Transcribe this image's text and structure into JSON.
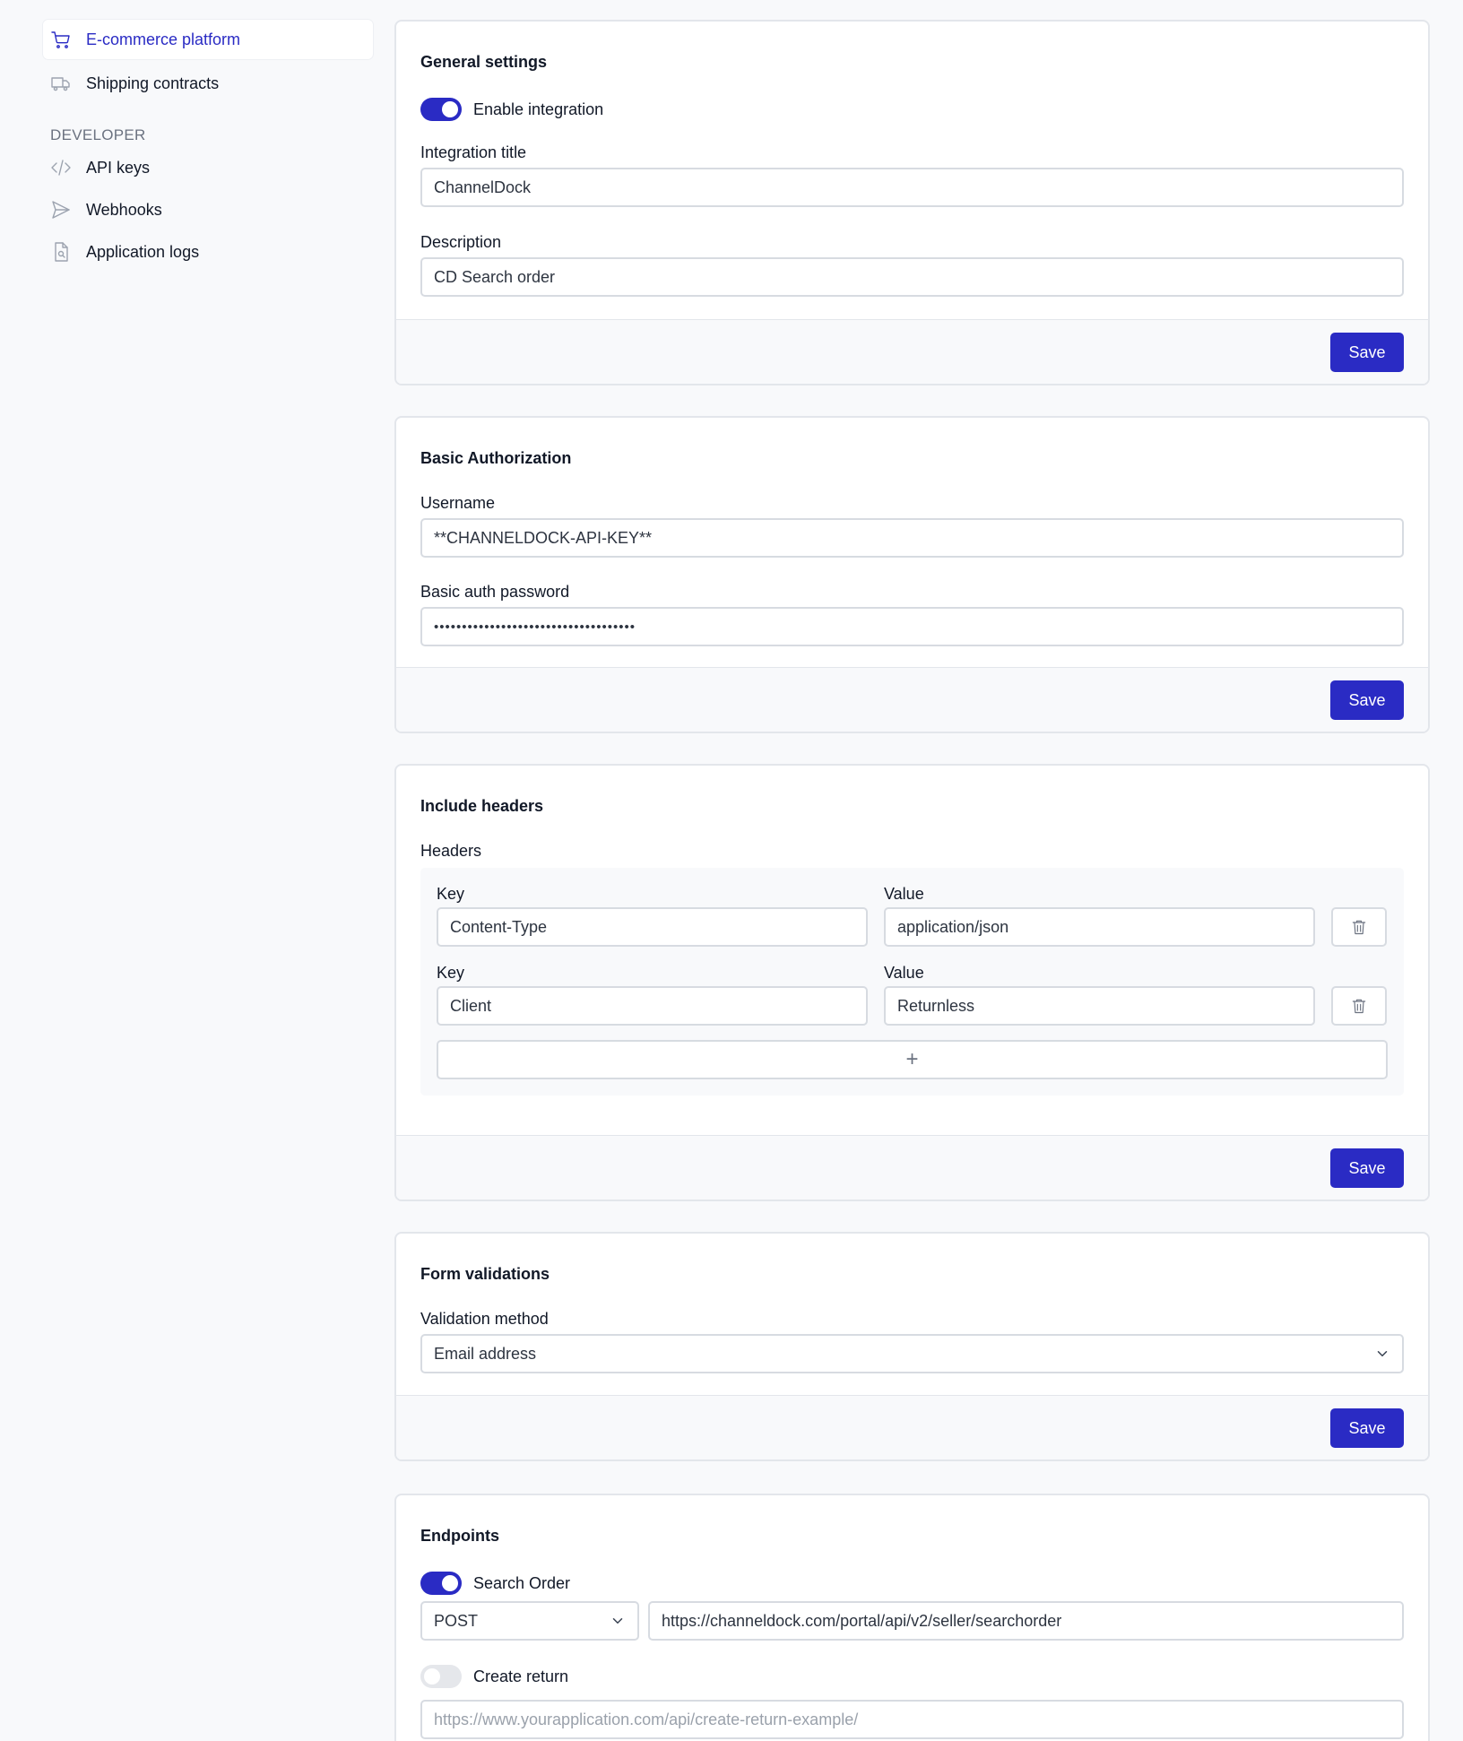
{
  "sidebar": {
    "items": [
      {
        "label": "E-commerce platform",
        "icon": "cart-icon",
        "active": true
      },
      {
        "label": "Shipping contracts",
        "icon": "truck-icon",
        "active": false
      }
    ],
    "developer_heading": "DEVELOPER",
    "developer_items": [
      {
        "label": "API keys",
        "icon": "code-icon"
      },
      {
        "label": "Webhooks",
        "icon": "send-icon"
      },
      {
        "label": "Application logs",
        "icon": "document-search-icon"
      }
    ]
  },
  "general": {
    "title": "General settings",
    "enable_label": "Enable integration",
    "enabled": true,
    "integration_title_label": "Integration title",
    "integration_title_value": "ChannelDock",
    "description_label": "Description",
    "description_value": "CD Search order",
    "save_label": "Save"
  },
  "basic_auth": {
    "title": "Basic Authorization",
    "username_label": "Username",
    "username_value": "**CHANNELDOCK-API-KEY**",
    "password_label": "Basic auth password",
    "password_value": "••••••••••••••••••••••••••••••••••••",
    "save_label": "Save"
  },
  "headers": {
    "title": "Include headers",
    "headers_label": "Headers",
    "rows": [
      {
        "key_label": "Key",
        "key": "Content-Type",
        "value_label": "Value",
        "value": "application/json"
      },
      {
        "key_label": "Key",
        "key": "Client",
        "value_label": "Value",
        "value": "Returnless"
      }
    ],
    "add_symbol": "+",
    "save_label": "Save"
  },
  "form_validations": {
    "title": "Form validations",
    "method_label": "Validation method",
    "method_value": "Email address",
    "save_label": "Save"
  },
  "endpoints": {
    "title": "Endpoints",
    "search_order_label": "Search Order",
    "search_order_enabled": true,
    "search_order_method": "POST",
    "search_order_url": "https://channeldock.com/portal/api/v2/seller/searchorder",
    "create_return_label": "Create return",
    "create_return_enabled": false,
    "create_return_placeholder": "https://www.yourapplication.com/api/create-return-example/"
  },
  "colors": {
    "accent": "#2a2bc4",
    "border": "#d7dbe1",
    "background": "#f8f9fb"
  }
}
